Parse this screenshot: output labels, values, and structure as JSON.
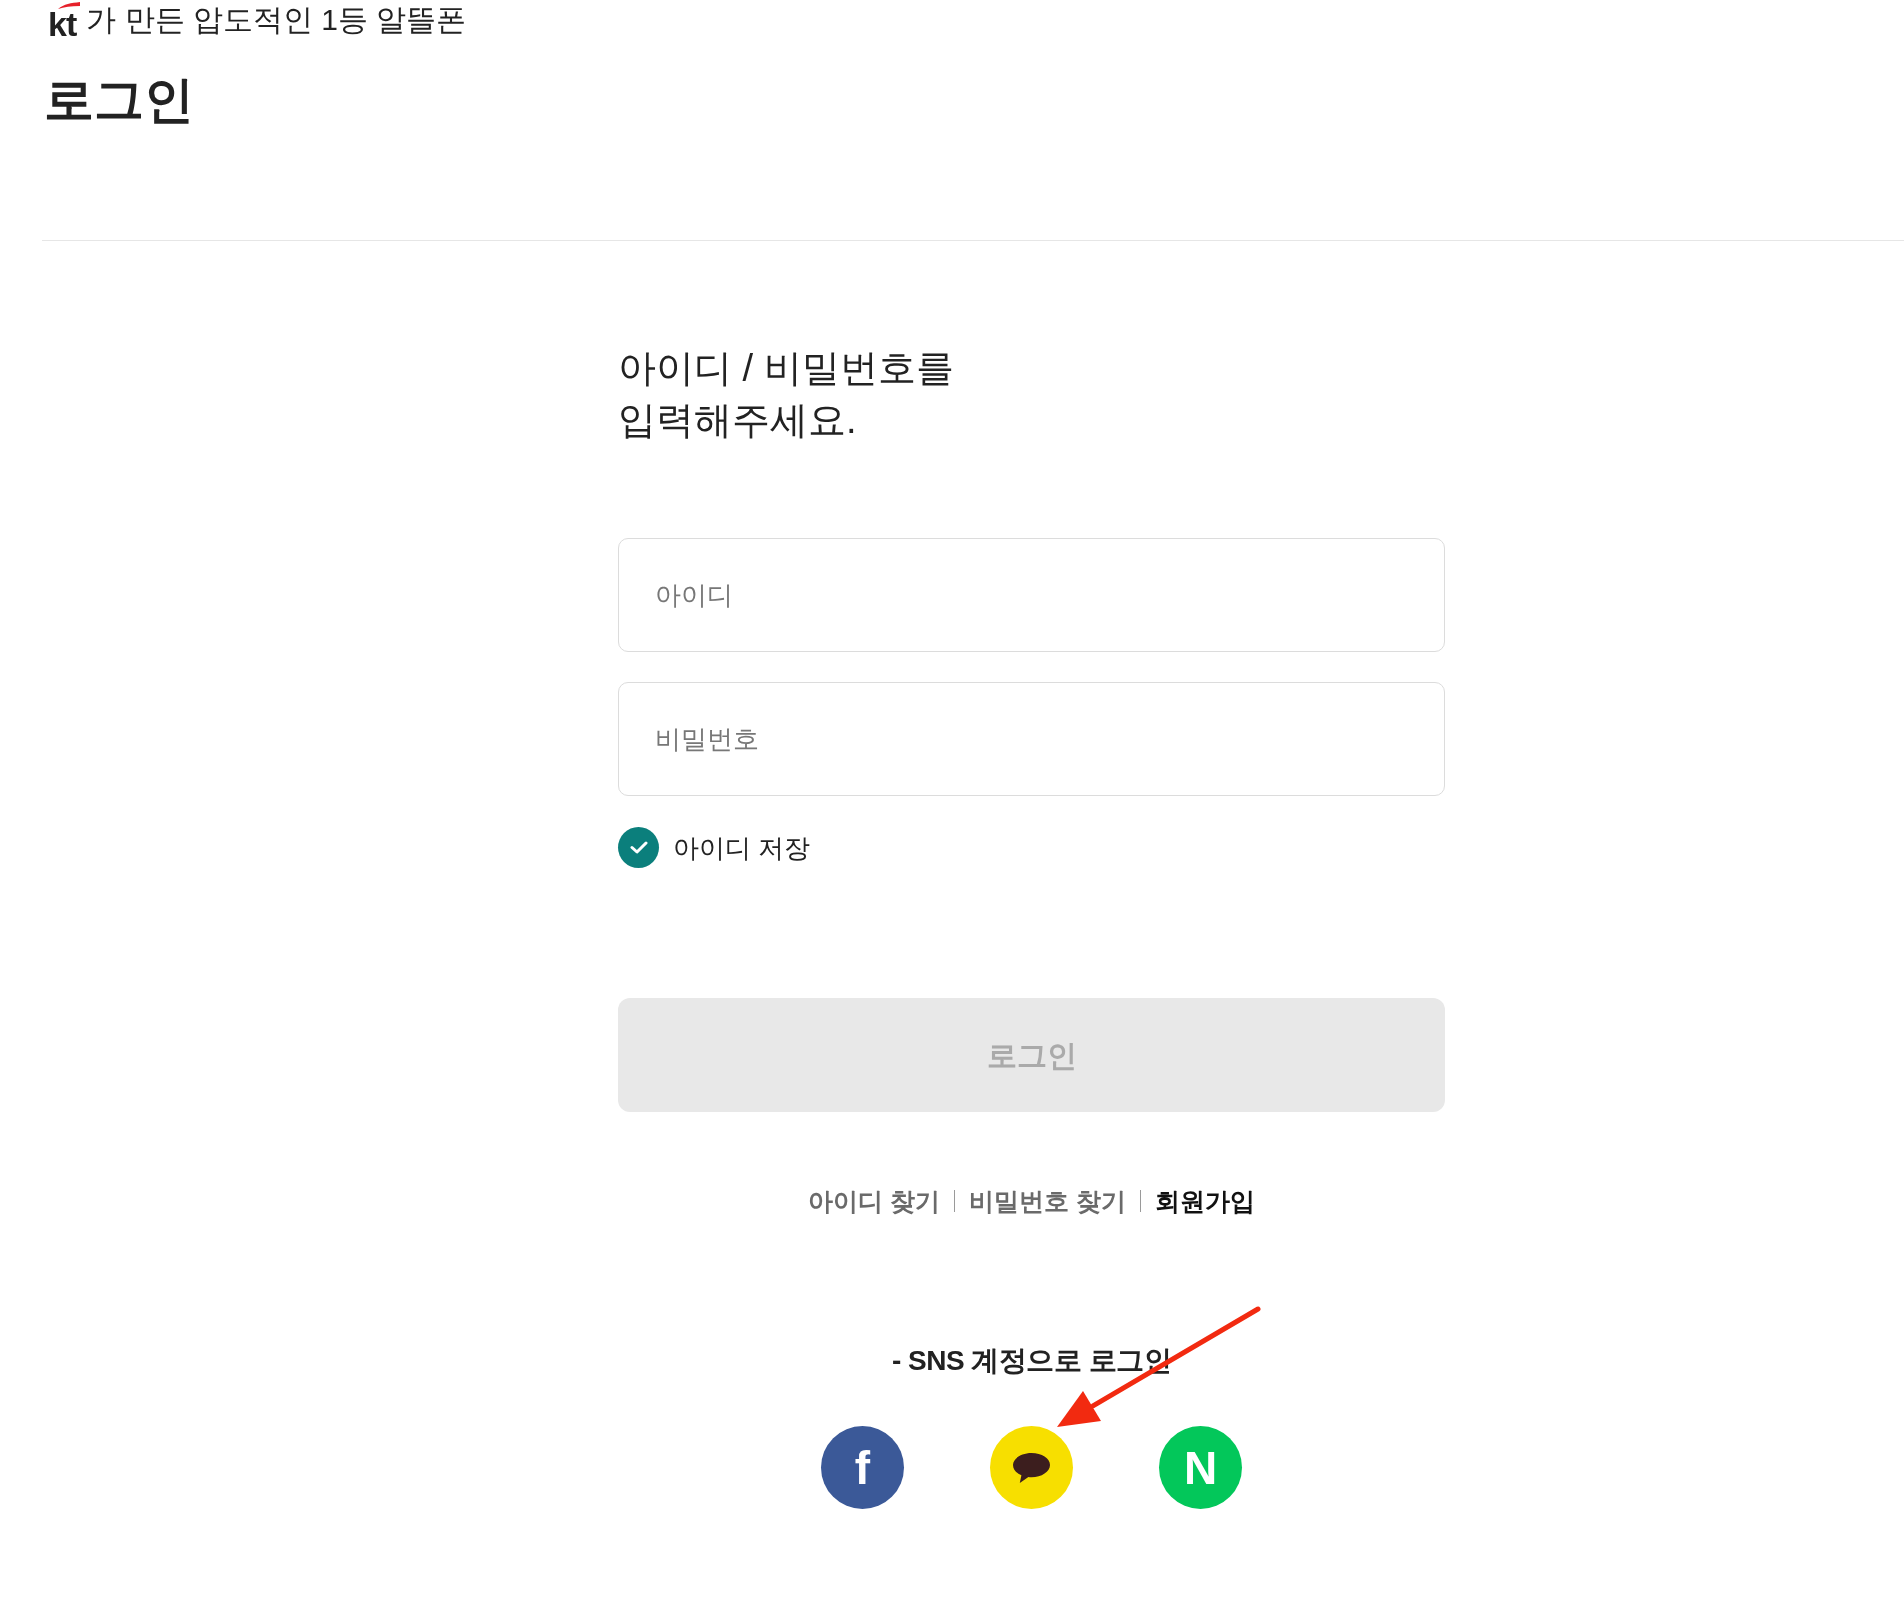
{
  "header": {
    "logo": "kt",
    "tagline": "가 만든 압도적인 1등 알뜰폰"
  },
  "page_title": "로그인",
  "prompt": "아이디 / 비밀번호를\n입력해주세요.",
  "fields": [
    {
      "placeholder": "아이디"
    },
    {
      "placeholder": "비밀번호"
    }
  ],
  "save_id": {
    "label": "아이디 저장",
    "checked": true
  },
  "login_button": {
    "label": "로그인",
    "disabled": true
  },
  "links": [
    {
      "label": "아이디 찾기",
      "emphasized": false
    },
    {
      "label": "비밀번호 찾기",
      "emphasized": false
    },
    {
      "label": "회원가입",
      "emphasized": true
    }
  ],
  "sns": {
    "title": "- SNS 계정으로 로그인",
    "buttons": [
      {
        "kind": "letter",
        "glyph": "f",
        "color": "#3b5998"
      },
      {
        "kind": "chat",
        "color": "#f7df00"
      },
      {
        "kind": "letter",
        "glyph": "N",
        "color": "#03c75a"
      }
    ]
  }
}
